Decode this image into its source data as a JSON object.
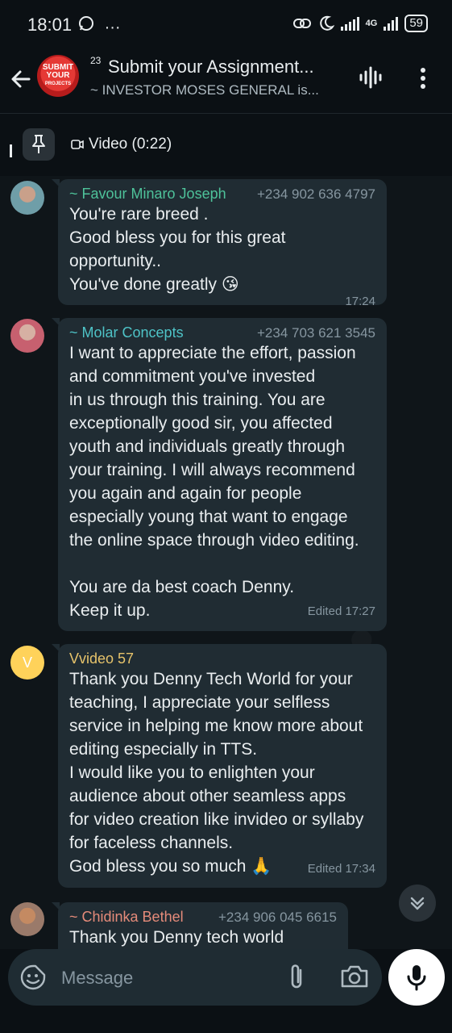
{
  "status_bar": {
    "time": "18:01",
    "network": "4G",
    "battery": "59"
  },
  "header": {
    "group_avatar_text": [
      "SUBMIT",
      "YOUR",
      "PROJECTS"
    ],
    "unread_count": "23",
    "title": "Submit your Assignment...",
    "subtitle": "~ INVESTOR MOSES GENERAL is..."
  },
  "pinned": {
    "label": "Video (0:22)"
  },
  "messages": [
    {
      "sender": "~ Favour Minaro Joseph",
      "sender_color": "#4ec29a",
      "phone": "+234 902 636 4797",
      "lines": [
        "You're rare breed .",
        "Good bless you for this great",
        "opportunity..",
        "You've done greatly"
      ],
      "emoji": "😘",
      "meta": "17:24"
    },
    {
      "sender": "~ Molar Concepts",
      "sender_color": "#4ec3c7",
      "phone": "+234 703 621 3545",
      "lines": [
        "I want to appreciate the effort, passion",
        "and commitment you've invested",
        "in us through this training. You are",
        "exceptionally good sir, you affected",
        "youth and individuals greatly through",
        "your training. I will always recommend",
        "you again and again for people",
        "especially young that want to engage",
        "the online space through video editing.",
        "",
        "You are da best coach Denny.",
        "Keep it up."
      ],
      "meta": "Edited 17:27"
    },
    {
      "sender": "Vvideo 57",
      "sender_color": "#e6c36b",
      "avatar_letter": "V",
      "lines": [
        "Thank you Denny Tech World for your",
        "teaching, I appreciate your selfless",
        "service in helping me know more about",
        "editing especially in TTS.",
        "I would like you to enlighten your",
        "audience about other seamless  apps",
        "for video creation like invideo or syllaby",
        "for faceless channels.",
        "God bless you so much"
      ],
      "emoji": "🙏",
      "meta": "Edited 17:34"
    },
    {
      "sender": "~ Chidinka Bethel",
      "sender_color": "#e58b7a",
      "phone": "+234 906 045 6615",
      "lines": [
        "Thank you Denny tech world"
      ]
    }
  ],
  "composer": {
    "placeholder": "Message"
  },
  "icons": {
    "back": "arrow-left-icon",
    "voice_chat": "waveform-icon",
    "menu": "kebab-menu-icon",
    "pin": "pin-icon",
    "video": "video-camera-icon",
    "scroll": "double-chevron-down-icon",
    "emoji": "sticker-emoji-icon",
    "attach": "paperclip-icon",
    "camera": "camera-icon",
    "mic": "microphone-icon"
  }
}
